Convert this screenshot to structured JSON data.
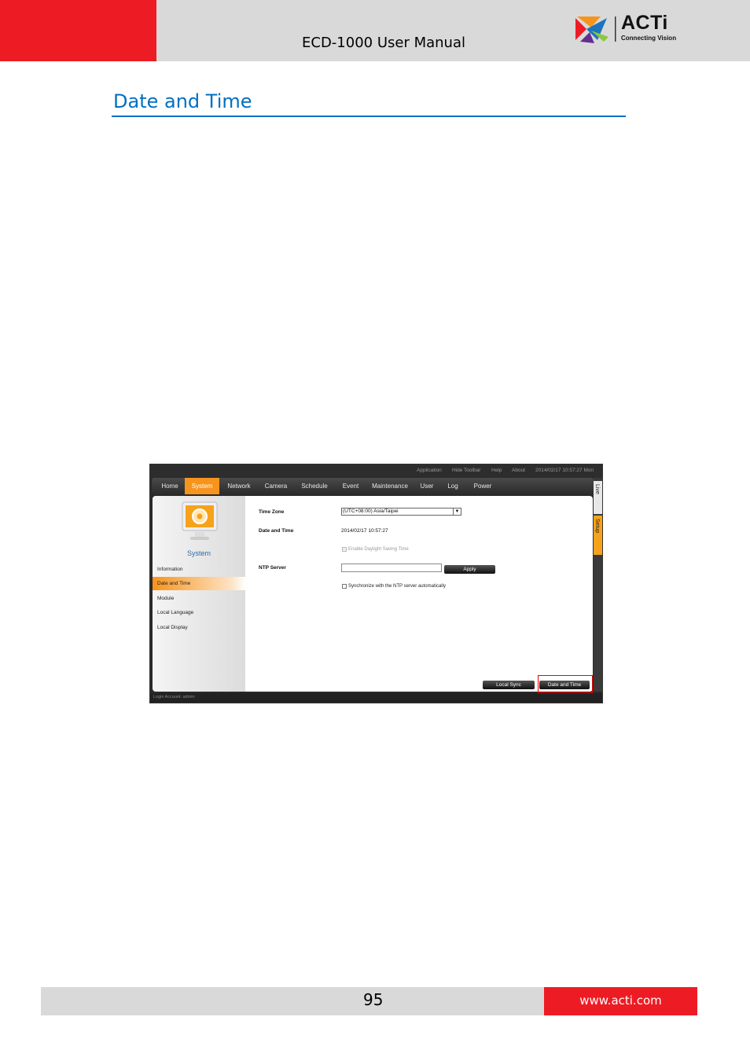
{
  "header": {
    "manual_title": "ECD-1000 User Manual",
    "logo_name": "ACTi",
    "logo_tagline": "Connecting Vision",
    "colors": {
      "red": "#ed1c24",
      "gray": "#d9d9d9"
    }
  },
  "section": {
    "title": "Date and Time",
    "accent": "#0070c0"
  },
  "screenshot": {
    "topbar": {
      "application": "Application",
      "hide_toolbar": "Hide Toolbar",
      "help": "Help",
      "about": "About",
      "datetime": "2014/02/17 10:57:27 Mon"
    },
    "nav": [
      "Home",
      "System",
      "Network",
      "Camera",
      "Schedule",
      "Event",
      "Maintenance",
      "User",
      "Log",
      "Power"
    ],
    "nav_active": "System",
    "sidebar": {
      "icon": "monitor-gear-icon",
      "title": "System",
      "items": [
        "Information",
        "Date and Time",
        "Module",
        "Local Language",
        "Local Display"
      ],
      "active": "Date and Time"
    },
    "form": {
      "time_zone_label": "Time Zone",
      "time_zone_value": "(UTC+08:00) Asia/Taipei",
      "date_time_label": "Date and Time",
      "date_time_value": "2014/02/17 10:57:27",
      "dst_label": "Enable Daylight Saving Time",
      "ntp_label": "NTP Server",
      "ntp_value": "",
      "apply_label": "Apply",
      "sync_label": "Synchronize with the NTP server automatically"
    },
    "buttons": {
      "local_sync": "Local Sync",
      "date_and_time": "Date and Time"
    },
    "right_tabs": {
      "live": "Live",
      "setup": "Setup"
    },
    "status": "Login Account: admin"
  },
  "footer": {
    "page_number": "95",
    "website": "www.acti.com"
  }
}
